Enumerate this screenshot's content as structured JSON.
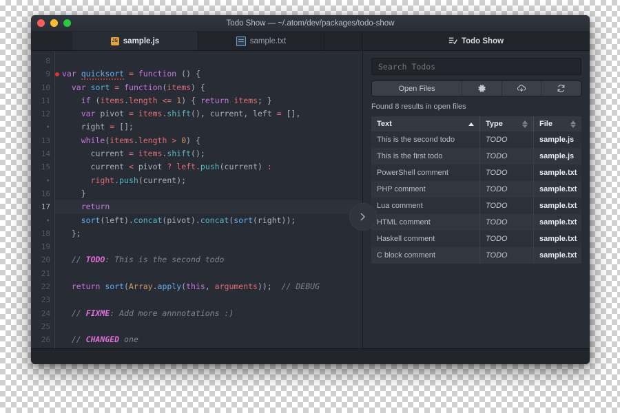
{
  "window": {
    "title": "Todo Show — ~/.atom/dev/packages/todo-show",
    "traffic": {
      "close": "close-button",
      "minimize": "minimize-button",
      "maximize": "maximize-button"
    }
  },
  "tabs": [
    {
      "label": "sample.js",
      "icon": "js-file-icon",
      "icon_text": "JS",
      "active": true
    },
    {
      "label": "sample.txt",
      "icon": "text-file-icon",
      "icon_text": "",
      "active": false
    }
  ],
  "todo_tab": {
    "label": "Todo Show",
    "icon": "todo-list-icon"
  },
  "editor": {
    "gutter": [
      {
        "num": "8",
        "breakpoint": false,
        "current": false
      },
      {
        "num": "9",
        "breakpoint": true,
        "current": false
      },
      {
        "num": "10",
        "breakpoint": false,
        "current": false
      },
      {
        "num": "11",
        "breakpoint": false,
        "current": false
      },
      {
        "num": "12",
        "breakpoint": false,
        "current": false
      },
      {
        "num": "•",
        "breakpoint": false,
        "current": false
      },
      {
        "num": "13",
        "breakpoint": false,
        "current": false
      },
      {
        "num": "14",
        "breakpoint": false,
        "current": false
      },
      {
        "num": "15",
        "breakpoint": false,
        "current": false
      },
      {
        "num": "•",
        "breakpoint": false,
        "current": false
      },
      {
        "num": "16",
        "breakpoint": false,
        "current": false
      },
      {
        "num": "17",
        "breakpoint": false,
        "current": true
      },
      {
        "num": "•",
        "breakpoint": false,
        "current": false
      },
      {
        "num": "18",
        "breakpoint": false,
        "current": false
      },
      {
        "num": "19",
        "breakpoint": false,
        "current": false
      },
      {
        "num": "20",
        "breakpoint": false,
        "current": false
      },
      {
        "num": "21",
        "breakpoint": false,
        "current": false
      },
      {
        "num": "22",
        "breakpoint": false,
        "current": false
      },
      {
        "num": "23",
        "breakpoint": false,
        "current": false
      },
      {
        "num": "24",
        "breakpoint": false,
        "current": false
      },
      {
        "num": "25",
        "breakpoint": false,
        "current": false
      },
      {
        "num": "26",
        "breakpoint": false,
        "current": false
      }
    ],
    "lines": [
      "",
      "var quicksort = function () {",
      "  var sort = function(items) {",
      "    if (items.length <= 1) { return items; }",
      "    var pivot = items.shift(), current, left = [],",
      "    right = [];",
      "    while(items.length > 0) {",
      "      current = items.shift();",
      "      current < pivot ? left.push(current) :",
      "      right.push(current);",
      "    }",
      "    return",
      "    sort(left).concat(pivot).concat(sort(right));",
      "  };",
      "",
      "  // TODO: This is the second todo",
      "",
      "  return sort(Array.apply(this, arguments));  // DEBUG",
      "",
      "  // FIXME: Add more annnotations :)",
      "",
      "  // CHANGED one"
    ]
  },
  "panel": {
    "search": {
      "placeholder": "Search Todos",
      "value": ""
    },
    "buttons": [
      {
        "label": "Open Files",
        "name": "open-files-button",
        "icon": ""
      },
      {
        "label": "",
        "name": "settings-button",
        "icon": "gear-icon"
      },
      {
        "label": "",
        "name": "save-todos-button",
        "icon": "cloud-download-icon"
      },
      {
        "label": "",
        "name": "refresh-button",
        "icon": "refresh-icon"
      }
    ],
    "status": "Found 8 results in open files",
    "table": {
      "columns": [
        "Text",
        "Type",
        "File"
      ],
      "sort": {
        "column": "Text",
        "direction": "asc"
      },
      "rows": [
        {
          "text": "This is the second todo",
          "type": "TODO",
          "file": "sample.js"
        },
        {
          "text": "This is the first todo",
          "type": "TODO",
          "file": "sample.js"
        },
        {
          "text": "PowerShell comment",
          "type": "TODO",
          "file": "sample.txt"
        },
        {
          "text": "PHP comment",
          "type": "TODO",
          "file": "sample.txt"
        },
        {
          "text": "Lua comment",
          "type": "TODO",
          "file": "sample.txt"
        },
        {
          "text": "HTML comment",
          "type": "TODO",
          "file": "sample.txt"
        },
        {
          "text": "Haskell comment",
          "type": "TODO",
          "file": "sample.txt"
        },
        {
          "text": "C block comment",
          "type": "TODO",
          "file": "sample.txt"
        }
      ]
    }
  },
  "divider": {
    "icon": "chevron-right-icon"
  },
  "colors": {
    "background": "#282c34",
    "chrome": "#21252b",
    "keyword": "#c678dd",
    "function": "#61afef",
    "variable": "#e06c75",
    "method": "#56b6c2",
    "number": "#d19a66",
    "comment": "#7f848e",
    "todo_keyword": "#e06fd8",
    "breakpoint": "#e0342b"
  }
}
